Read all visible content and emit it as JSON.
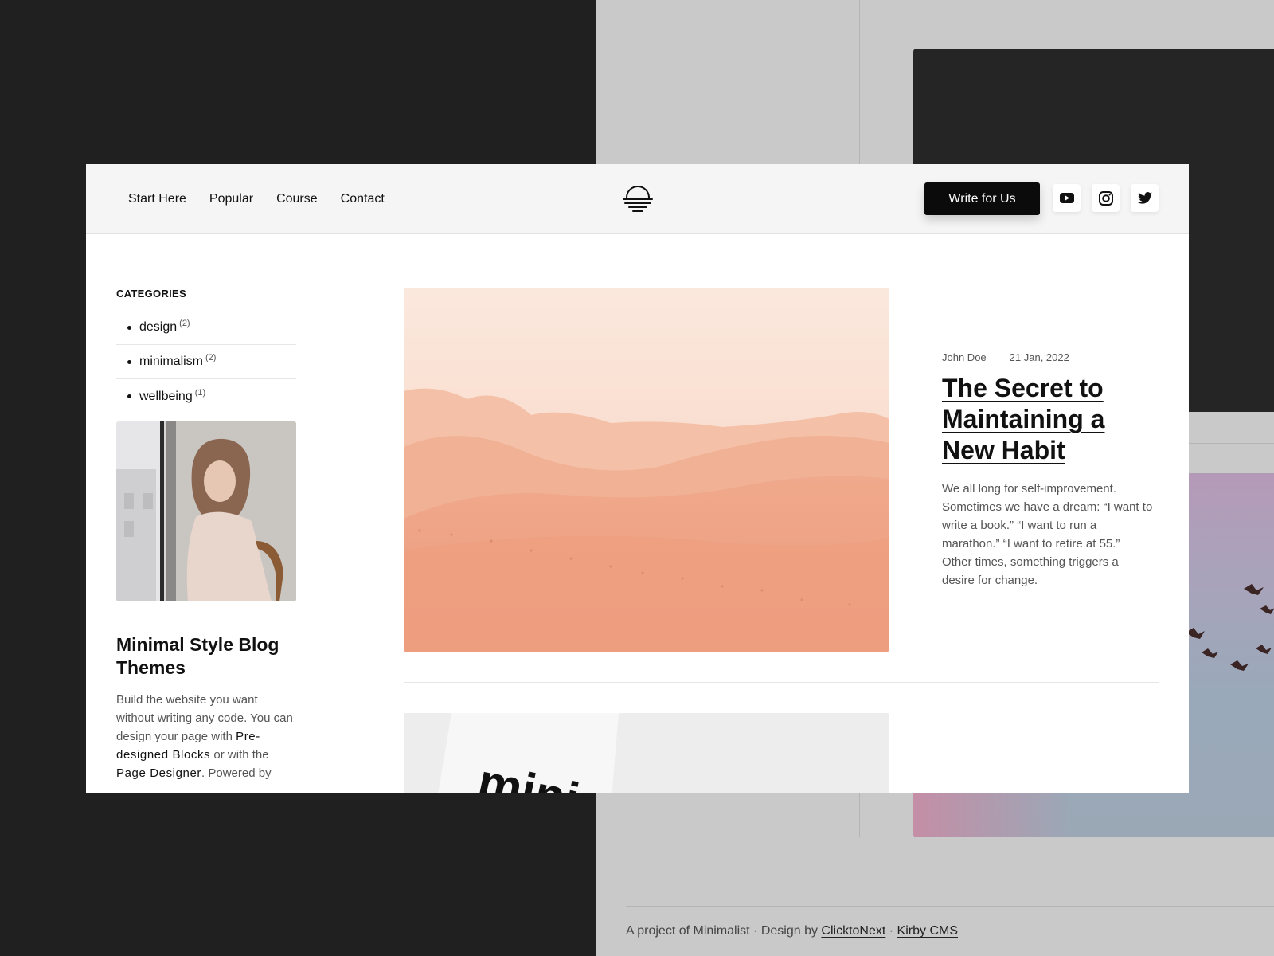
{
  "nav": {
    "items": [
      {
        "label": "Start Here"
      },
      {
        "label": "Popular"
      },
      {
        "label": "Course"
      },
      {
        "label": "Contact"
      }
    ],
    "cta_label": "Write for Us",
    "logo_icon": "sunset-logo-icon",
    "social": [
      {
        "icon": "youtube-icon"
      },
      {
        "icon": "instagram-icon"
      },
      {
        "icon": "twitter-icon"
      }
    ]
  },
  "sidebar": {
    "categories_heading": "CATEGORIES",
    "categories": [
      {
        "name": "design",
        "count": "(2)"
      },
      {
        "name": "minimalism",
        "count": "(2)"
      },
      {
        "name": "wellbeing",
        "count": "(1)"
      }
    ],
    "promo": {
      "title": "Minimal Style Blog Themes",
      "text_1": "Build the website you want without writing any code. You can design your page with ",
      "link_1": "Pre-designed Blocks",
      "text_2": " or with the ",
      "link_2": "Page Designer",
      "text_3": ". Powered by"
    }
  },
  "featured_post": {
    "author": "John Doe",
    "date": "21 Jan, 2022",
    "title": "The Secret to Maintaining a New Habit",
    "excerpt": "We all long for self-improvement. Sometimes we have a dream: “I want to write a book.” “I want to run a marathon.” “I want to retire at 55.” Other times, something triggers a desire for change."
  },
  "second_post": {
    "image_text": "mini"
  },
  "background_footer": {
    "text_1": "A project of Minimalist · Design by ",
    "link_1": "ClicktoNext",
    "text_2": " · ",
    "link_2": "Kirby CMS"
  },
  "colors": {
    "button_bg": "#0b0b0b",
    "topbar_bg": "#f5f5f5",
    "desert_peach": "#f0a98c"
  }
}
